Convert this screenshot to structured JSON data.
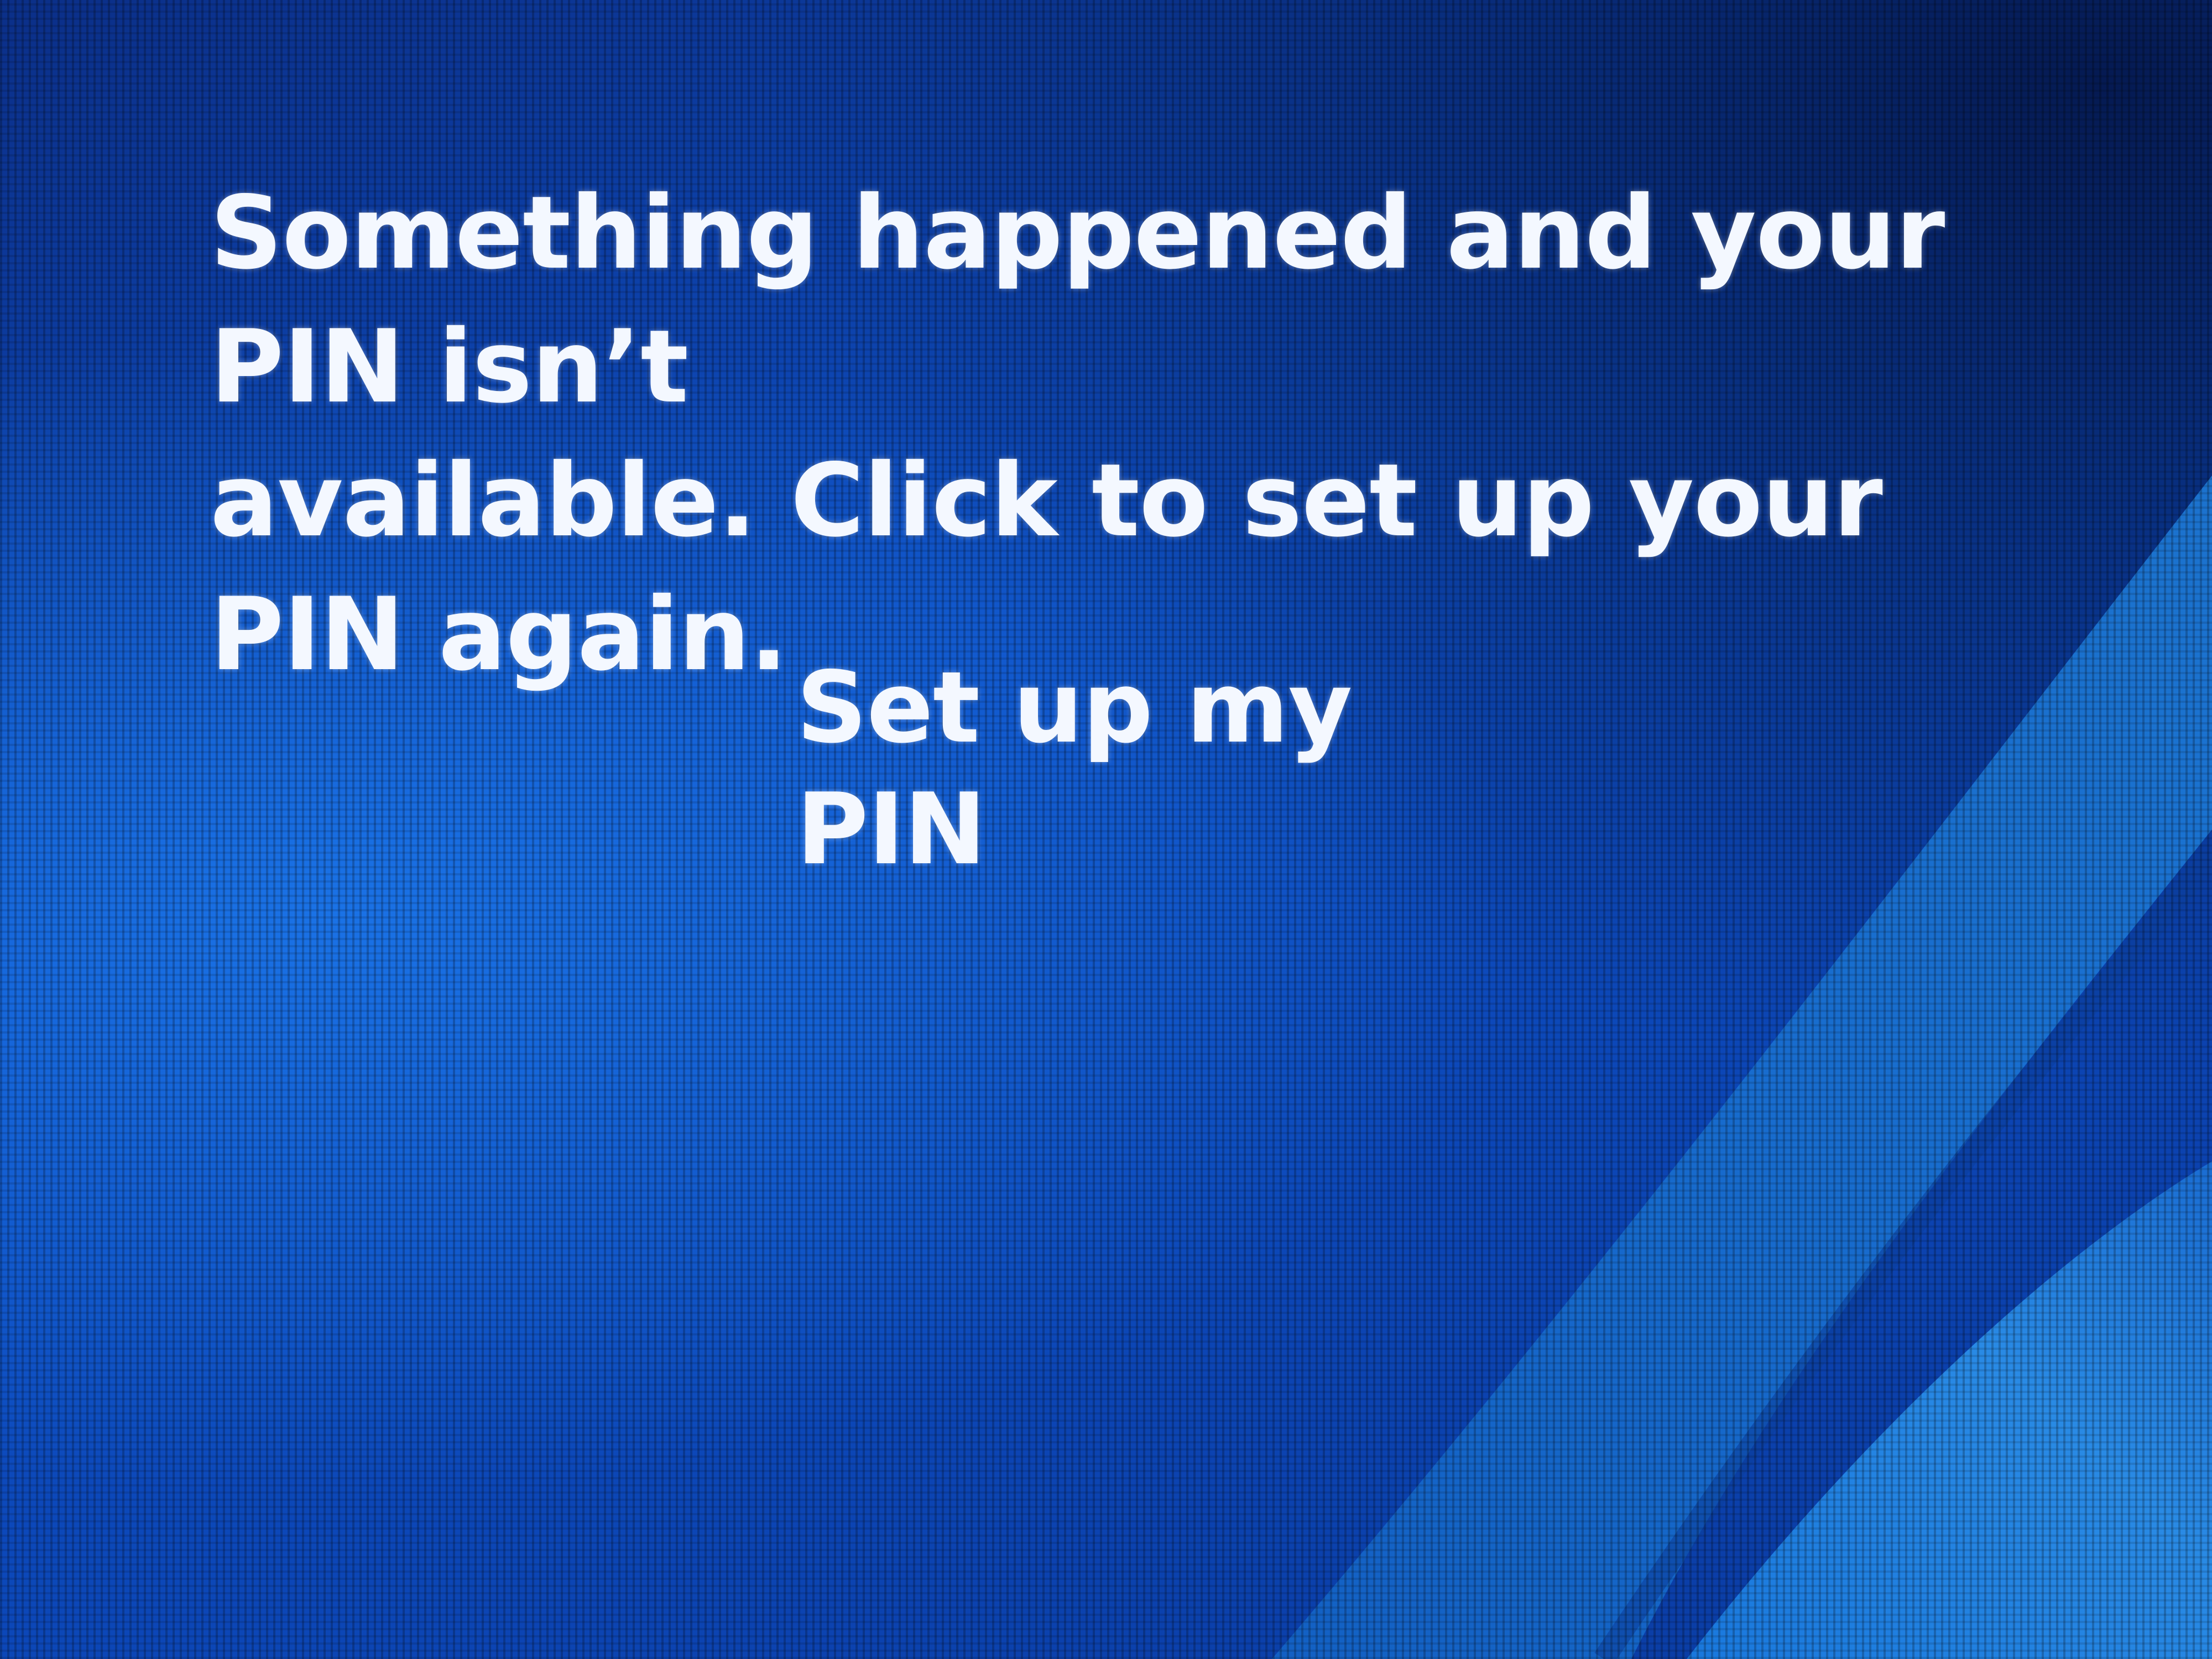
{
  "lock_screen": {
    "message_line1": "Something happened and your PIN isn’t",
    "message_line2": "available. Click to set up your PIN again.",
    "setup_link_label": "Set up my PIN"
  },
  "colors": {
    "background": "#0e4fc4",
    "text": "#f4f8ff",
    "ribbon": "#1c7ee0"
  }
}
